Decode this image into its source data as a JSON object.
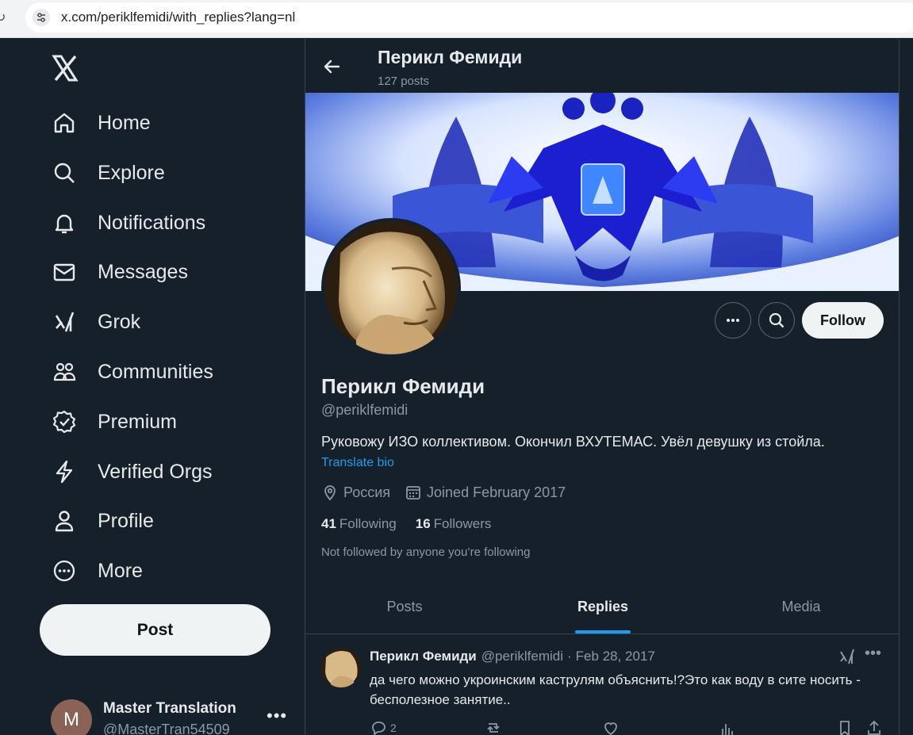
{
  "browser": {
    "url": "x.com/periklfemidi/with_replies?lang=nl"
  },
  "sidebar": {
    "items": [
      {
        "label": "Home",
        "icon": "home-icon"
      },
      {
        "label": "Explore",
        "icon": "search-icon"
      },
      {
        "label": "Notifications",
        "icon": "bell-icon"
      },
      {
        "label": "Messages",
        "icon": "envelope-icon"
      },
      {
        "label": "Grok",
        "icon": "grok-icon"
      },
      {
        "label": "Communities",
        "icon": "people-icon"
      },
      {
        "label": "Premium",
        "icon": "verified-badge-icon"
      },
      {
        "label": "Verified Orgs",
        "icon": "lightning-icon"
      },
      {
        "label": "Profile",
        "icon": "person-icon"
      },
      {
        "label": "More",
        "icon": "more-circle-icon"
      }
    ],
    "post_label": "Post",
    "account": {
      "initial": "M",
      "name": "Master Translation",
      "handle": "@MasterTran54509",
      "avatar_color": "#8a6356"
    }
  },
  "header": {
    "title": "Перикл Фемиди",
    "subtitle": "127 posts"
  },
  "profile": {
    "name": "Перикл Фемиди",
    "handle": "@periklfemidi",
    "bio": "Руковожу ИЗО коллективом. Окончил ВХУТЕМАС. Увёл девушку из стойла.",
    "translate_label": "Translate bio",
    "location": "Россия",
    "joined": "Joined February 2017",
    "following_count": "41",
    "following_label": "Following",
    "followers_count": "16",
    "followers_label": "Followers",
    "not_followed": "Not followed by anyone you’re following",
    "follow_label": "Follow"
  },
  "tabs": [
    {
      "label": "Posts",
      "active": false
    },
    {
      "label": "Replies",
      "active": true
    },
    {
      "label": "Media",
      "active": false
    }
  ],
  "tweet": {
    "name": "Перикл Фемиди",
    "handle": "@periklfemidi",
    "separator": "·",
    "date": "Feb 28, 2017",
    "text": "да чего можно укроинским каструлям объяснить!?Это как воду в сите носить - бесполезное занятие..",
    "reply_count": "2"
  },
  "colors": {
    "background": "#15202b",
    "accent": "#1d9bf0",
    "border": "#38444d",
    "muted_text": "#8b98a5"
  }
}
